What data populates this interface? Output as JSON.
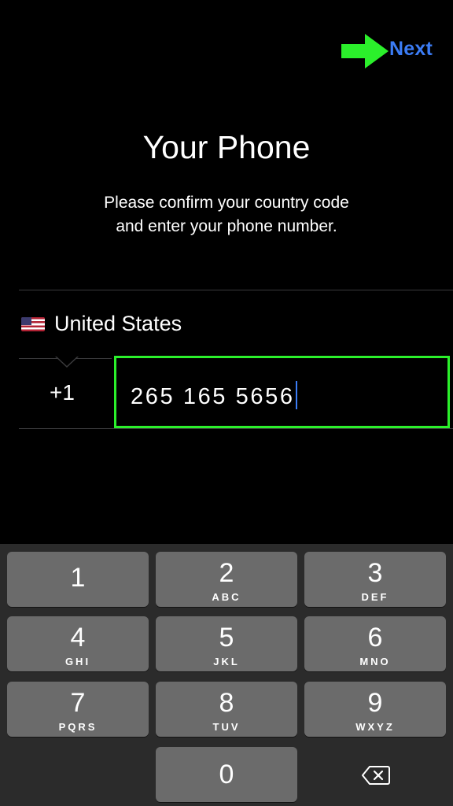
{
  "header": {
    "next_label": "Next",
    "annotation_color": "#2bf02b",
    "link_color": "#3b7cf5"
  },
  "title": "Your Phone",
  "subtitle_line1": "Please confirm your country code",
  "subtitle_line2": "and enter your phone number.",
  "country": {
    "flag_icon": "us-flag-icon",
    "name": "United States"
  },
  "phone": {
    "country_code": "+1",
    "number": "265 165 5656"
  },
  "keypad": {
    "keys": [
      {
        "digit": "1",
        "letters": ""
      },
      {
        "digit": "2",
        "letters": "ABC"
      },
      {
        "digit": "3",
        "letters": "DEF"
      },
      {
        "digit": "4",
        "letters": "GHI"
      },
      {
        "digit": "5",
        "letters": "JKL"
      },
      {
        "digit": "6",
        "letters": "MNO"
      },
      {
        "digit": "7",
        "letters": "PQRS"
      },
      {
        "digit": "8",
        "letters": "TUV"
      },
      {
        "digit": "9",
        "letters": "WXYZ"
      },
      {
        "digit": "0",
        "letters": ""
      }
    ],
    "delete_icon": "backspace-icon"
  }
}
